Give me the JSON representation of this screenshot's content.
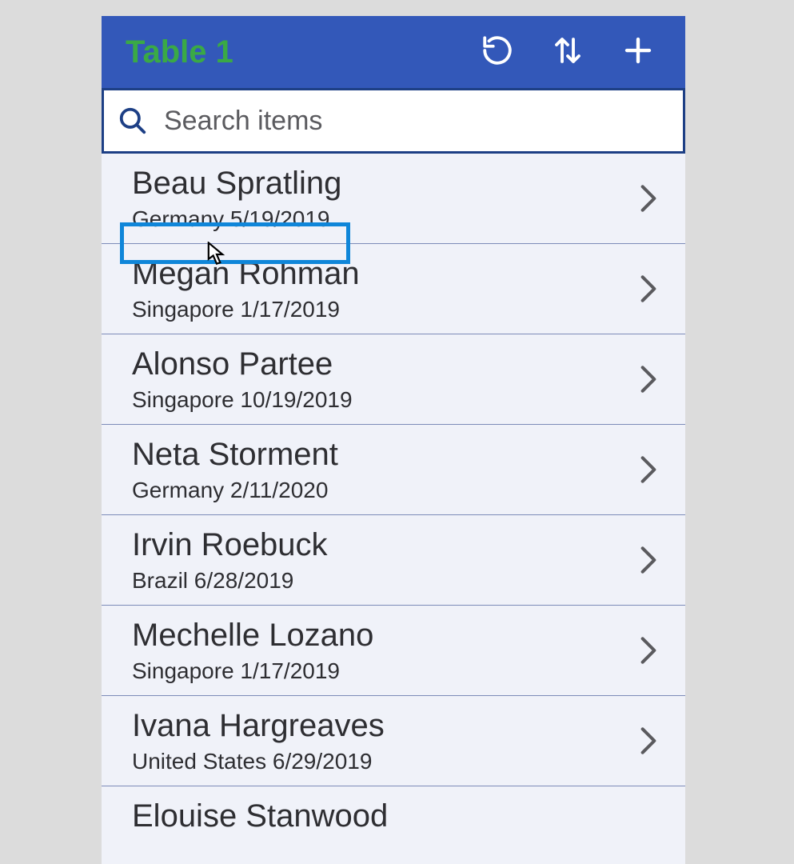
{
  "header": {
    "title": "Table 1"
  },
  "search": {
    "placeholder": "Search items"
  },
  "items": [
    {
      "name": "Beau Spratling",
      "detail": "Germany 5/19/2019"
    },
    {
      "name": "Megan Rohman",
      "detail": "Singapore 1/17/2019"
    },
    {
      "name": "Alonso Partee",
      "detail": "Singapore 10/19/2019"
    },
    {
      "name": "Neta Storment",
      "detail": "Germany 2/11/2020"
    },
    {
      "name": "Irvin Roebuck",
      "detail": "Brazil 6/28/2019"
    },
    {
      "name": "Mechelle Lozano",
      "detail": "Singapore 1/17/2019"
    },
    {
      "name": "Ivana Hargreaves",
      "detail": "United States 6/29/2019"
    },
    {
      "name": "Elouise Stanwood",
      "detail": ""
    }
  ]
}
